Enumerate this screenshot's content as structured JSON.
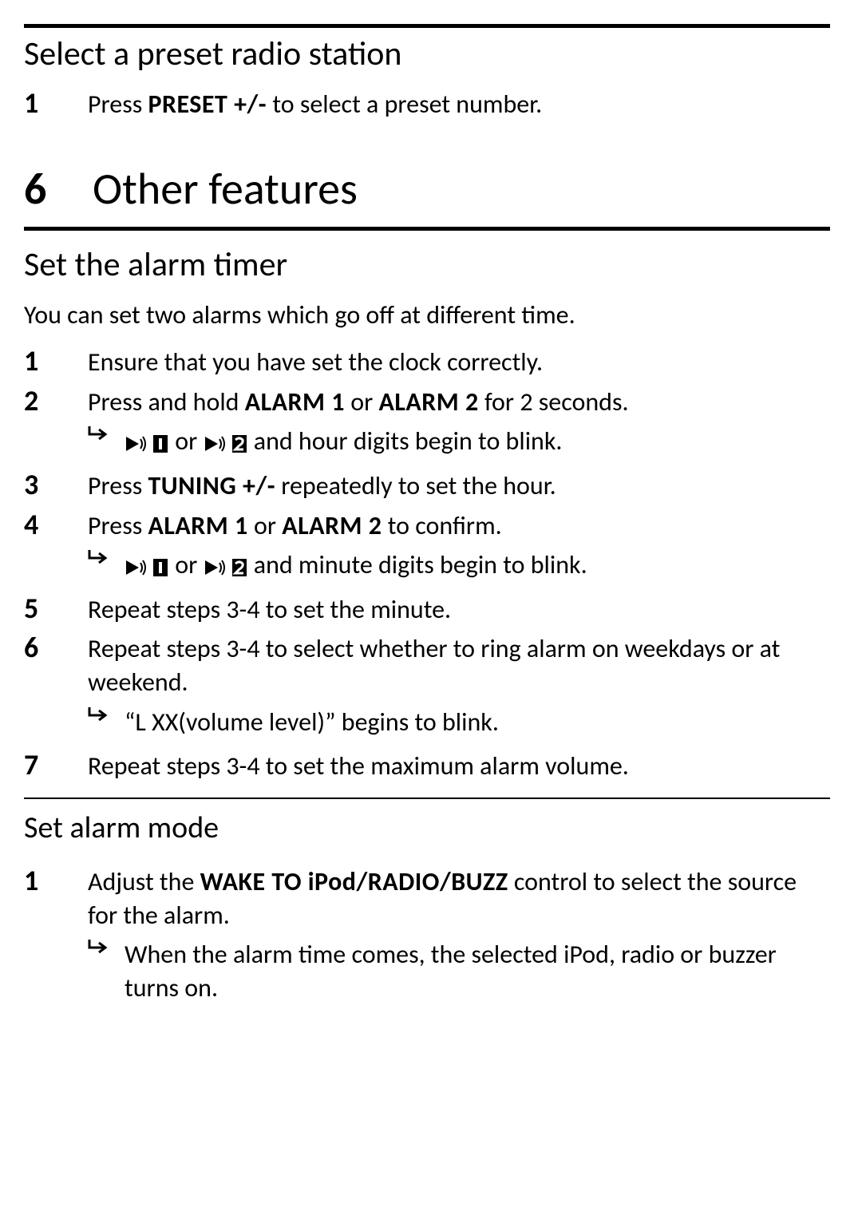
{
  "section1": {
    "title": "Select a preset radio station",
    "steps": [
      {
        "pre": "Press ",
        "control": "PRESET +/-",
        "post": " to select a preset number."
      }
    ]
  },
  "chapter": {
    "number": "6",
    "title": "Other features"
  },
  "alarm": {
    "title": "Set the alarm timer",
    "intro": "You can set two alarms which go off at different time.",
    "step1": "Ensure that you have set the clock correctly.",
    "step2_pre": "Press and hold ",
    "step2_a1": "ALARM 1",
    "step2_or": " or ",
    "step2_a2": "ALARM 2",
    "step2_post": " for 2 seconds.",
    "step2_result_sep": " or ",
    "step2_result_post": " and hour digits begin to blink.",
    "step3_pre": "Press ",
    "step3_ctrl": "TUNING +/-",
    "step3_post": " repeatedly to set the hour.",
    "step4_pre": "Press ",
    "step4_a1": "ALARM 1",
    "step4_or": " or ",
    "step4_a2": "ALARM 2",
    "step4_post": " to confirm.",
    "step4_result_sep": " or ",
    "step4_result_post": " and minute digits begin to blink.",
    "step5": "Repeat steps 3-4 to set the minute.",
    "step6": "Repeat steps 3-4 to select whether to ring alarm on weekdays or at weekend.",
    "step6_result": "“L XX(volume level)” begins to blink.",
    "step7": "Repeat steps 3-4 to set the maximum alarm volume."
  },
  "mode": {
    "title": "Set alarm mode",
    "step1_pre": "Adjust the ",
    "step1_ctrl": "WAKE TO iPod/RADIO/BUZZ",
    "step1_post": " control to select the source for the alarm.",
    "step1_result": "When the alarm time comes, the selected iPod, radio or buzzer turns on."
  }
}
